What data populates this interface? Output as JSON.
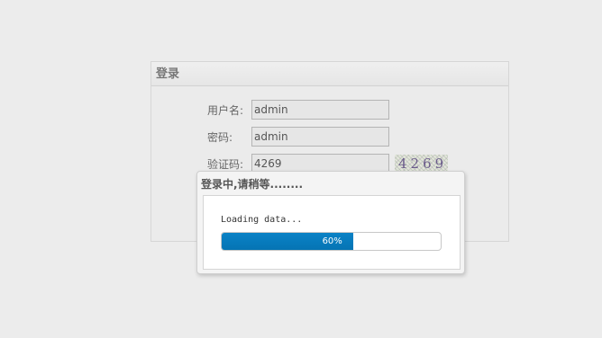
{
  "login": {
    "title": "登录",
    "username_label": "用户名:",
    "username_value": "admin",
    "password_label": "密码:",
    "password_value": "admin",
    "captcha_label": "验证码:",
    "captcha_value": "4269",
    "captcha_image_text": "4269"
  },
  "loading": {
    "title": "登录中,请稍等........",
    "message": "Loading data...",
    "progress_percent": 60,
    "progress_label": "60%"
  },
  "colors": {
    "progress_fill": "#0a82c6",
    "background": "#ececec"
  }
}
